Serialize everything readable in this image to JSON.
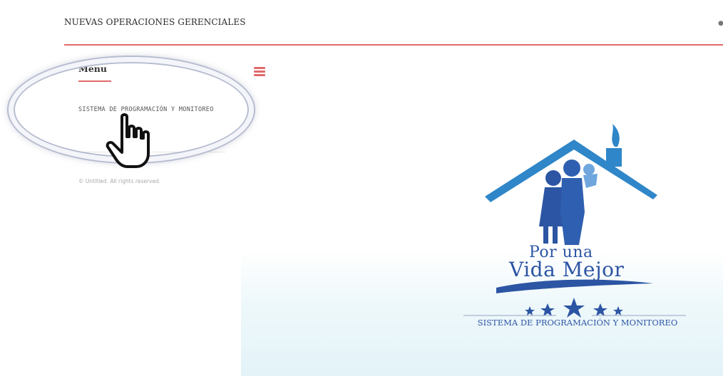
{
  "header": {
    "title": "NUEVAS OPERACIONES GERENCIALES"
  },
  "sidebar": {
    "menu_title": "Menu",
    "items": [
      {
        "label": "SISTEMA DE PROGRAMACIÓN Y MONITOREO"
      }
    ],
    "footer": "© Untitled. All rights reserved."
  },
  "logo": {
    "line1": "Por una",
    "line2": "Vida Mejor",
    "caption": "SISTEMA DE PROGRAMACIÓN Y MONITOREO"
  },
  "colors": {
    "accent": "#e26a6a",
    "logo_blue": "#2c55a3",
    "roof_blue": "#2f86c8"
  },
  "icons": {
    "menu_toggle": "hamburger-icon",
    "pointer": "hand-pointer-icon",
    "header_edge": "user-icon"
  }
}
